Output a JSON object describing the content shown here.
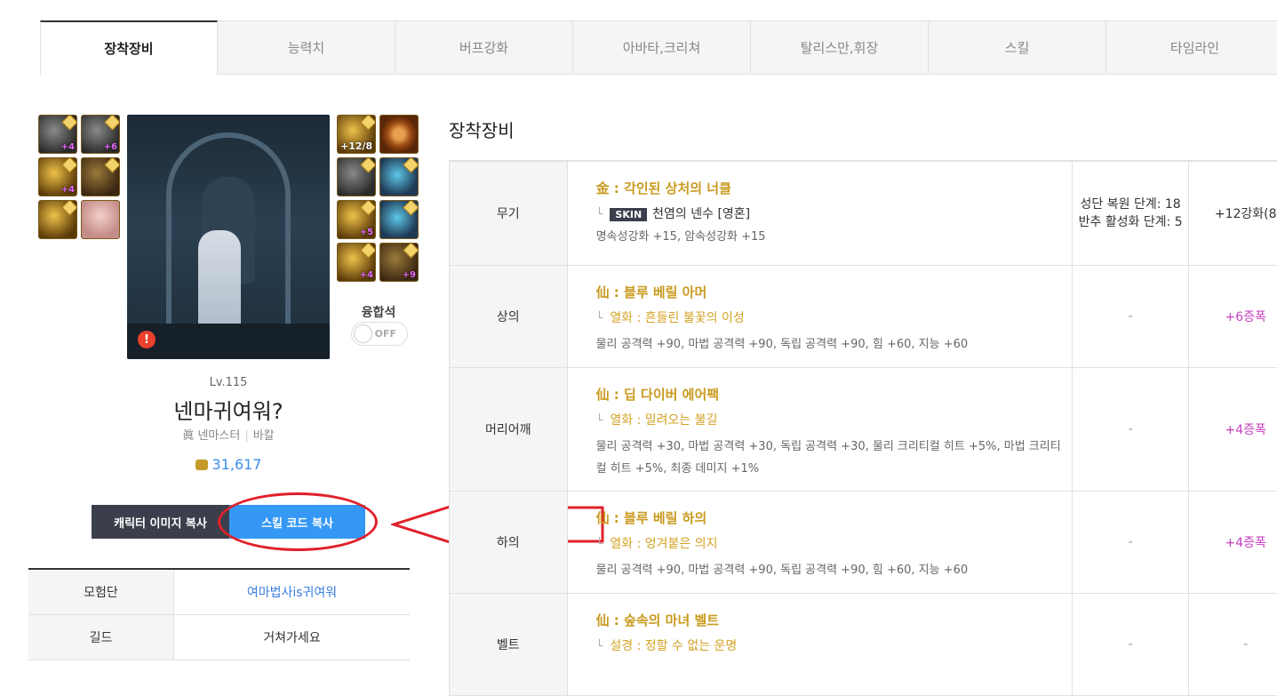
{
  "tabs": [
    "장착장비",
    "능력치",
    "버프강화",
    "아바타,크리쳐",
    "탈리스만,휘장",
    "스킬",
    "타임라인"
  ],
  "character": {
    "level": "Lv.115",
    "name": "넨마귀여워?",
    "class": "眞 넨마스터",
    "server": "바칼",
    "power": "31,617",
    "fusion_label": "융합석",
    "fusion_toggle": "OFF",
    "warning_icon": "!"
  },
  "slots_left": [
    {
      "icon": "shoulder-icon",
      "badge": "+4",
      "style": "dark"
    },
    {
      "icon": "top-icon",
      "badge": "+6",
      "style": "dark"
    },
    {
      "icon": "bottom-icon",
      "badge": "+4",
      "style": "gold"
    },
    {
      "icon": "belt-icon",
      "badge": "",
      "style": "brown"
    },
    {
      "icon": "shoes-icon",
      "badge": "",
      "style": "gold"
    },
    {
      "icon": "portrait-icon",
      "badge": "",
      "style": "face"
    }
  ],
  "slots_right": [
    {
      "icon": "weapon-icon",
      "badge": "+12/8",
      "style": "gold"
    },
    {
      "icon": "title-icon",
      "badge": "",
      "style": "ring"
    },
    {
      "icon": "bracelet-icon",
      "badge": "",
      "style": "dark"
    },
    {
      "icon": "necklace-icon",
      "badge": "",
      "style": "blue"
    },
    {
      "icon": "ring-icon",
      "badge": "+5",
      "style": "gold"
    },
    {
      "icon": "support-icon",
      "badge": "",
      "style": "blue"
    },
    {
      "icon": "magic-stone-icon",
      "badge": "+4",
      "style": "gold"
    },
    {
      "icon": "earring-icon",
      "badge": "+9",
      "style": "brown"
    }
  ],
  "buttons": {
    "copy_image": "캐릭터 이미지 복사",
    "copy_skill_code": "스킬 코드 복사"
  },
  "info": {
    "adventure_label": "모험단",
    "adventure_value": "여마법사is귀여워",
    "guild_label": "길드",
    "guild_value": "거쳐가세요"
  },
  "section_title": "장착장비",
  "equipment": [
    {
      "slot": "무기",
      "name": "金 : 각인된 상처의 너클",
      "skin_badge": "SKIN",
      "sub": "천염의 넨수 [영혼]",
      "stats": "명속성강화 +15, 암속성강화 +15",
      "col3_line1": "성단 복원 단계: 18",
      "col3_line2": "반추 활성화 단계: 5",
      "col4": "+12강화(8"
    },
    {
      "slot": "상의",
      "name": "仙 : 블루 베릴 아머",
      "sub": "열화 : 흔들린 불꽃의 이성",
      "stats": "물리 공격력 +90, 마법 공격력 +90, 독립 공격력 +90, 힘 +60, 지능 +60",
      "col3": "-",
      "col4": "+6증폭"
    },
    {
      "slot": "머리어깨",
      "name": "仙 : 딥 다이버 에어팩",
      "sub": "열화 : 밀려오는 불길",
      "stats": "물리 공격력 +30, 마법 공격력 +30, 독립 공격력 +30, 물리 크리티컬 히트 +5%, 마법 크리티컬 히트 +5%, 최종 데미지 +1%",
      "col3": "-",
      "col4": "+4증폭"
    },
    {
      "slot": "하의",
      "name": "仙 : 블루 베릴 하의",
      "sub": "열화 : 엉겨붙은 의지",
      "stats": "물리 공격력 +90, 마법 공격력 +90, 독립 공격력 +90, 힘 +60, 지능 +60",
      "col3": "-",
      "col4": "+4증폭"
    },
    {
      "slot": "벨트",
      "name": "仙 : 숲속의 마녀 벨트",
      "sub": "설경 : 정할 수 없는 운명",
      "stats": "",
      "col3": "-",
      "col4": "-"
    }
  ],
  "branch_symbol": "└",
  "colors": {
    "accent_blue": "#3498f4",
    "gold_text": "#c99a1e",
    "purple": "#c43fbf",
    "annotation_red": "#e0202a"
  }
}
